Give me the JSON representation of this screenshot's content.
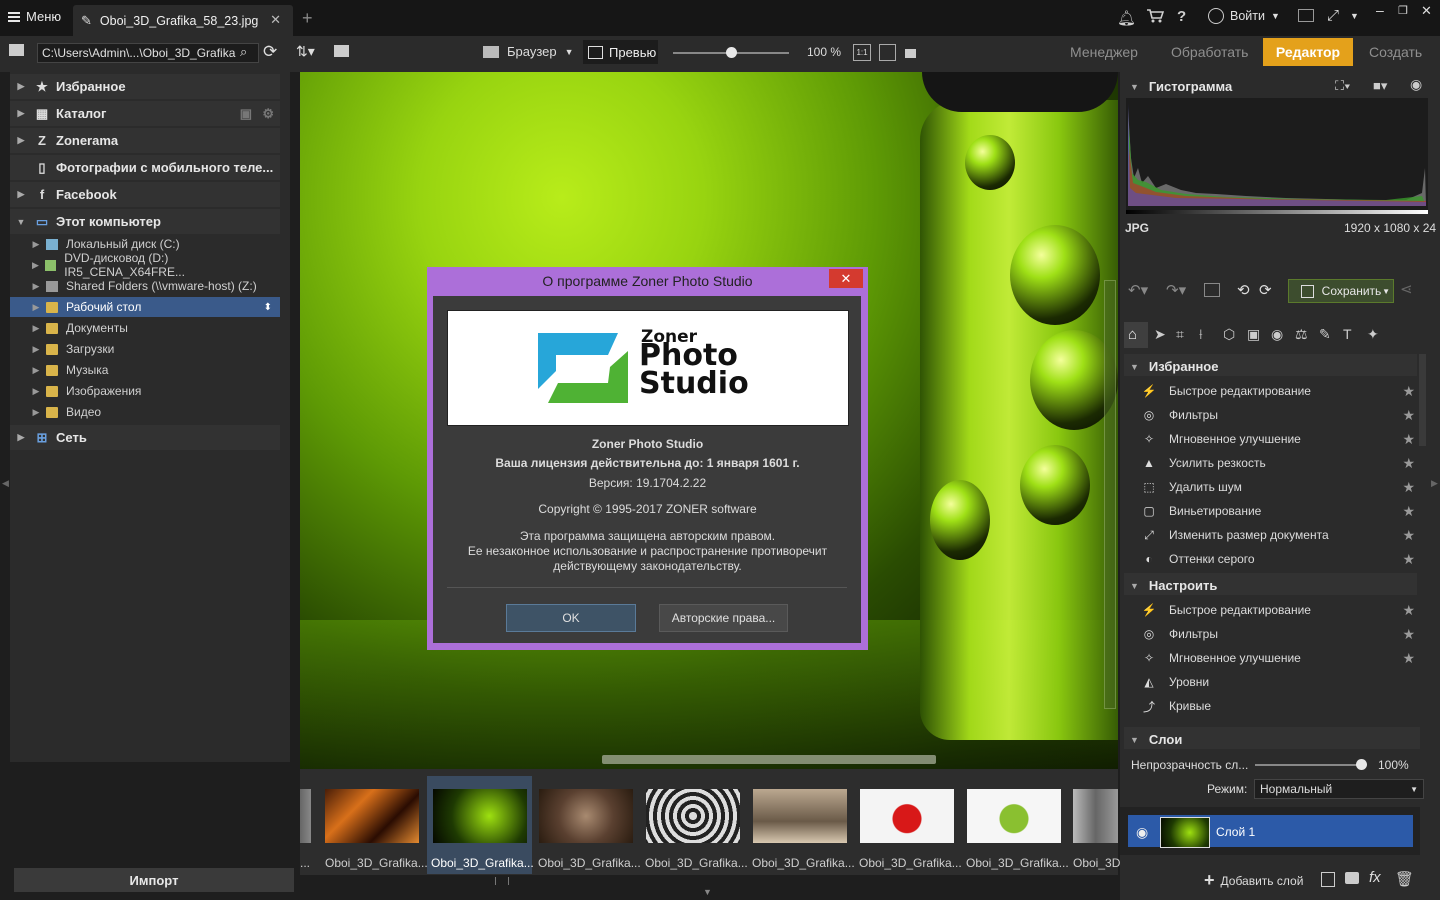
{
  "titlebar": {
    "menu_label": "Меню",
    "tab_title": "Oboi_3D_Grafika_58_23.jpg",
    "new_tab": "+",
    "login_label": "Войти",
    "help": "?"
  },
  "toolbar": {
    "path": "C:\\Users\\Admin\\...\\Oboi_3D_Grafika",
    "browser_label": "Браузер",
    "preview_label": "Превью",
    "zoom": "100 %",
    "one_to_one": "1:1",
    "modes": [
      "Менеджер",
      "Обработать",
      "Редактор",
      "Создать"
    ],
    "active_mode": "Редактор"
  },
  "left_panel": {
    "nav": [
      {
        "label": "Избранное",
        "icon": "star-icon"
      },
      {
        "label": "Каталог",
        "icon": "catalog-icon"
      },
      {
        "label": "Zonerama",
        "icon": "zonerama-icon"
      },
      {
        "label": "Фотографии с мобильного теле...",
        "icon": "phone-icon"
      },
      {
        "label": "Facebook",
        "icon": "facebook-icon"
      },
      {
        "label": "Этот компьютер",
        "icon": "computer-icon"
      }
    ],
    "computer_items": [
      "Локальный диск (C:)",
      "DVD-дисковод (D:) IR5_CENA_X64FRE...",
      "Shared Folders (\\\\vmware-host) (Z:)",
      "Рабочий стол",
      "Документы",
      "Загрузки",
      "Музыка",
      "Изображения",
      "Видео"
    ],
    "selected_item": "Рабочий стол",
    "network_label": "Сеть",
    "import_label": "Импорт"
  },
  "filmstrip": {
    "labels": [
      "Oboi_3D_Grafika...",
      "Oboi_3D_Grafika...",
      "Oboi_3D_Grafika...",
      "Oboi_3D_Grafika...",
      "Oboi_3D_Grafika...",
      "Oboi_3D_Grafika...",
      "Oboi_3D_Grafika...",
      "Oboi_3D"
    ],
    "selected_index": 1
  },
  "right_panel": {
    "histogram_title": "Гистограмма",
    "format": "JPG",
    "dimensions": "1920 x 1080 x 24",
    "save_label": "Сохранить",
    "favorites_title": "Избранное",
    "favorites": [
      {
        "label": "Быстрое редактирование",
        "icon": "bolt-icon"
      },
      {
        "label": "Фильтры",
        "icon": "filters-icon"
      },
      {
        "label": "Мгновенное улучшение",
        "icon": "magic-wand-icon"
      },
      {
        "label": "Усилить резкость",
        "icon": "sharpen-icon"
      },
      {
        "label": "Удалить шум",
        "icon": "noise-icon"
      },
      {
        "label": "Виньетирование",
        "icon": "vignette-icon"
      },
      {
        "label": "Изменить размер документа",
        "icon": "resize-icon"
      },
      {
        "label": "Оттенки серого",
        "icon": "grayscale-icon"
      }
    ],
    "adjust_title": "Настроить",
    "adjust": [
      {
        "label": "Быстрое редактирование",
        "icon": "bolt-icon"
      },
      {
        "label": "Фильтры",
        "icon": "filters-icon"
      },
      {
        "label": "Мгновенное улучшение",
        "icon": "magic-wand-icon"
      },
      {
        "label": "Уровни",
        "icon": "levels-icon"
      },
      {
        "label": "Кривые",
        "icon": "curves-icon"
      }
    ],
    "layers_title": "Слои",
    "opacity_label": "Непрозрачность сл...",
    "opacity_value": "100%",
    "mode_label": "Режим:",
    "mode_value": "Нормальный",
    "layer_name": "Слой 1",
    "add_layer_label": "Добавить слой",
    "fx": "fx"
  },
  "dialog": {
    "title": "О программе Zoner Photo Studio",
    "close": "✕",
    "logo_line1": "Zoner",
    "logo_line2": "Photo",
    "logo_line3": "Studio",
    "product": "Zoner Photo Studio",
    "license": "Ваша лицензия действительна до: 1 января 1601 г.",
    "version": "Версия: 19.1704.2.22",
    "copyright": "Copyright © 1995-2017 ZONER software",
    "legal1": "Эта программа защищена авторским правом.",
    "legal2": "Ее незаконное использование и распространение противоречит",
    "legal3": "действующему законодательству.",
    "ok_label": "OK",
    "credits_label": "Авторские права..."
  },
  "colors": {
    "accent": "#e4a11b",
    "dialog_border": "#ac6fd9",
    "selection": "#3a5a8a",
    "layer_selected": "#2c5aa8"
  }
}
